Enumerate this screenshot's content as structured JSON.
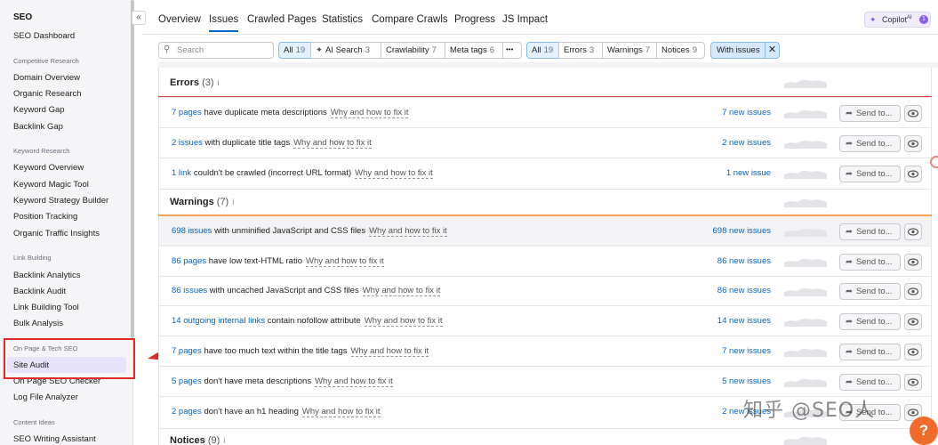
{
  "sidebar": {
    "title": "SEO",
    "dashboard": "SEO Dashboard",
    "sections": [
      {
        "label": "Competitive Research",
        "items": [
          "Domain Overview",
          "Organic Research",
          "Keyword Gap",
          "Backlink Gap"
        ]
      },
      {
        "label": "Keyword Research",
        "items": [
          "Keyword Overview",
          "Keyword Magic Tool",
          "Keyword Strategy Builder",
          "Position Tracking",
          "Organic Traffic Insights"
        ]
      },
      {
        "label": "Link Building",
        "items": [
          "Backlink Analytics",
          "Backlink Audit",
          "Link Building Tool",
          "Bulk Analysis"
        ]
      },
      {
        "label": "On Page & Tech SEO",
        "items": [
          "Site Audit",
          "On Page SEO Checker",
          "Log File Analyzer"
        ]
      },
      {
        "label": "Content Ideas",
        "items": [
          "SEO Writing Assistant"
        ]
      }
    ],
    "active_item": "Site Audit",
    "collapse_glyph": "«"
  },
  "tabs": [
    "Overview",
    "Issues",
    "Crawled Pages",
    "Statistics",
    "Compare Crawls",
    "Progress",
    "JS Impact"
  ],
  "active_tab": "Issues",
  "copilot": {
    "label": "Copilot",
    "superscript": "AI",
    "badge": "1"
  },
  "filters": {
    "search_placeholder": "Search",
    "category_group": [
      {
        "label": "All",
        "count": "19"
      },
      {
        "label": "AI Search",
        "count": "3"
      },
      {
        "label": "Crawlability",
        "count": "7"
      },
      {
        "label": "Meta tags",
        "count": "6"
      }
    ],
    "more_glyph": "•••",
    "type_group": [
      {
        "label": "All",
        "count": "19"
      },
      {
        "label": "Errors",
        "count": "3"
      },
      {
        "label": "Warnings",
        "count": "7"
      },
      {
        "label": "Notices",
        "count": "9"
      }
    ],
    "with_issues": "With issues",
    "clear_glyph": "✕"
  },
  "sections": {
    "errors": {
      "title": "Errors",
      "count": "(3)",
      "info": "i"
    },
    "warnings": {
      "title": "Warnings",
      "count": "(7)",
      "info": "i"
    },
    "notices": {
      "title": "Notices",
      "count": "(9)",
      "info": "i"
    }
  },
  "why_label": "Why and how to fix it",
  "send_label": "Send to...",
  "rows": [
    {
      "link": "7 pages",
      "text": "have duplicate meta descriptions",
      "new": "7 new issues"
    },
    {
      "link": "2 issues",
      "text": "with duplicate title tags",
      "new": "2 new issues"
    },
    {
      "link": "1 link",
      "text": "couldn't be crawled (incorrect URL format)",
      "new": "1 new issue"
    },
    {
      "link": "698 issues",
      "text": "with unminified JavaScript and CSS files",
      "new": "698 new issues"
    },
    {
      "link": "86 pages",
      "text": "have low text-HTML ratio",
      "new": "86 new issues"
    },
    {
      "link": "86 issues",
      "text": "with uncached JavaScript and CSS files",
      "new": "86 new issues"
    },
    {
      "link": "14 outgoing internal links",
      "text": "contain nofollow attribute",
      "new": "14 new issues"
    },
    {
      "link": "7 pages",
      "text": "have too much text within the title tags",
      "new": "7 new issues"
    },
    {
      "link": "5 pages",
      "text": "don't have meta descriptions",
      "new": "5 new issues"
    },
    {
      "link": "2 pages",
      "text": "don't have an h1 heading",
      "new": "2 new issues"
    }
  ],
  "watermark": "知乎 @SEO人",
  "help_glyph": "?"
}
